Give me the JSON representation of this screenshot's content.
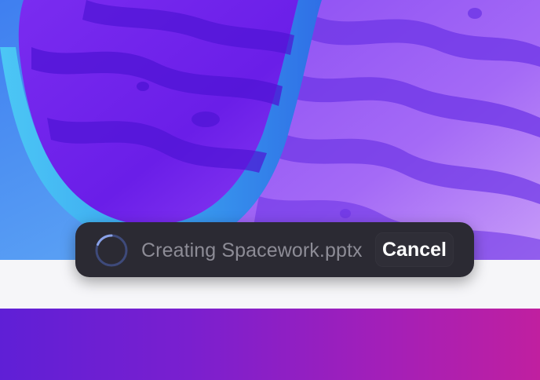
{
  "toast": {
    "status_text": "Creating Spacework.pptx",
    "cancel_label": "Cancel",
    "spinner_icon": "loading-spinner-icon",
    "background_color": "#2b2a33",
    "label_color": "#8d8c96",
    "button_text_color": "#ffffff"
  },
  "background": {
    "wallpaper_name": "abstract-purple-planet-wallpaper",
    "strip_color": "#f6f6f9",
    "band_gradient": [
      "#5f1fd6",
      "#c01fa0"
    ]
  }
}
